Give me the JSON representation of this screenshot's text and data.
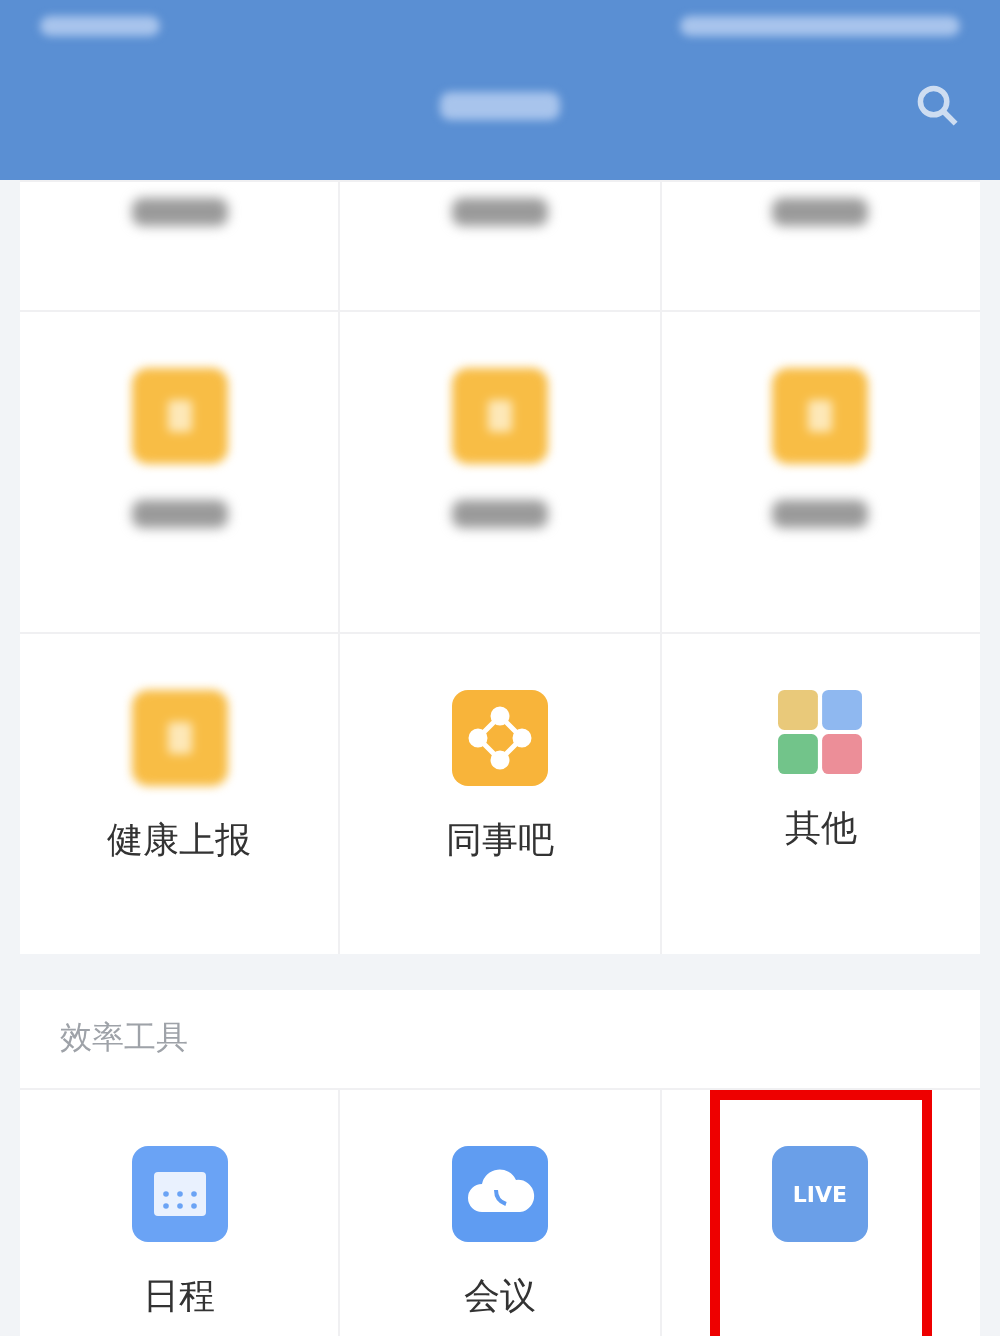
{
  "sections": [
    {
      "rows": [
        [
          {
            "kind": "label_only"
          },
          {
            "kind": "label_only"
          },
          {
            "kind": "label_only"
          }
        ],
        [
          {
            "kind": "plain",
            "color": "#f8bd45"
          },
          {
            "kind": "plain",
            "color": "#f8bd45"
          },
          {
            "kind": "plain",
            "color": "#f8bd45"
          }
        ],
        [
          {
            "kind": "plain",
            "color": "#f8bd45",
            "label": "健康上报"
          },
          {
            "kind": "share",
            "color": "#f8b43a",
            "label": "同事吧"
          },
          {
            "kind": "grid",
            "label": "其他"
          }
        ]
      ]
    },
    {
      "title": "效率工具",
      "rows": [
        [
          {
            "kind": "calendar",
            "color": "#6aa3f5",
            "label": "日程"
          },
          {
            "kind": "cloud",
            "color": "#5f9cf2",
            "label": "会议"
          },
          {
            "kind": "live",
            "color": "#6a9fe8",
            "highlighted": true,
            "live_text": "LIVE"
          }
        ]
      ]
    }
  ]
}
